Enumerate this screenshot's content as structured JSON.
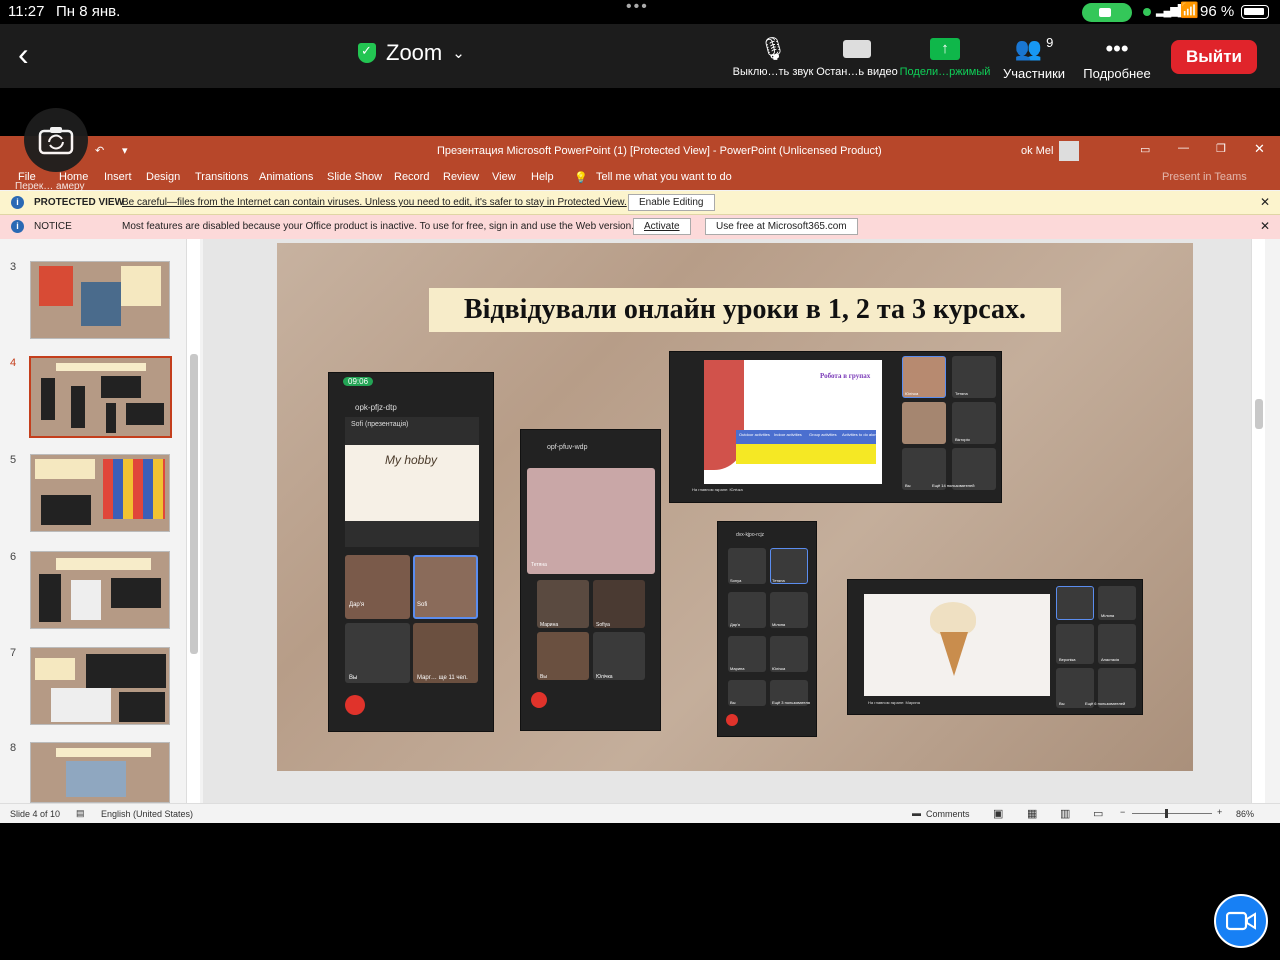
{
  "status": {
    "time": "11:27",
    "date": "Пн 8 янв.",
    "battery": "96 %"
  },
  "zoom": {
    "title": "Zoom",
    "mute": "Выклю…ть звук",
    "video": "Остан…ь видео",
    "share": "Подели…ржимый",
    "participants": "Участники",
    "participants_count": "9",
    "more": "Подробнее",
    "exit": "Выйти"
  },
  "ppt": {
    "window_title": "Презентация Microsoft PowerPoint (1) [Protected View]  -  PowerPoint (Unlicensed Product)",
    "user": "ok Mel",
    "camera_overlay": "Перек… амеру",
    "tabs": [
      "File",
      "Home",
      "Insert",
      "Design",
      "Transitions",
      "Animations",
      "Slide Show",
      "Record",
      "Review",
      "View",
      "Help"
    ],
    "tell_me": "Tell me what you want to do",
    "present_teams": "Present in Teams",
    "pv_label": "PROTECTED VIEW",
    "pv_text": "Be careful—files from the Internet can contain viruses. Unless you need to edit, it's safer to stay in Protected View.",
    "enable_editing": "Enable Editing",
    "notice_label": "NOTICE",
    "notice_text": "Most features are disabled because your Office product is inactive. To use for free, sign in and use the Web version.",
    "activate": "Activate",
    "use_free": "Use free at Microsoft365.com",
    "slide_numbers": [
      "3",
      "4",
      "5",
      "6",
      "7",
      "8"
    ],
    "slide_title": "Відвідували онлайн уроки в 1, 2 та 3 курсах.",
    "phone1": {
      "time": "09:06",
      "code": "opk-pfjz-dtp",
      "presenter": "Sofi (презентація)",
      "hobby": "My hobby",
      "tiles": [
        "Дар'я",
        "Sofi",
        "Вы",
        "Марг… ще 11 чел."
      ]
    },
    "phone2": {
      "code": "opf-pfuv-wdp",
      "names": [
        "Тетяна",
        "Марина",
        "Sofiya",
        "Вы",
        "Юлічка"
      ]
    },
    "meet1": {
      "heading": "Робота в групах",
      "cols": [
        "Outdoor activities",
        "Indoor activities",
        "Group activities",
        "Activities to do alone"
      ],
      "names": [
        "Юлічка",
        "Тетяна",
        "Вікторія",
        "Вы",
        "Ещё 14 пользователей"
      ],
      "bottom": "На главном экране: Юлічка"
    },
    "phone3": {
      "code": "dvx-kjpo-rcjz",
      "names": [
        "Sonya",
        "Тетяна",
        "Дар'я",
        "Міляна",
        "Марина",
        "Юлічка",
        "Вы",
        "Ещё 3 пользователя"
      ]
    },
    "meet2": {
      "names": [
        "Міляна",
        "Вероніка",
        "Анастасія",
        "Вы",
        "Ещё 6 пользователей"
      ],
      "bottom": "На главном экране: Марина"
    },
    "statusbar": {
      "slide": "Slide 4 of 10",
      "lang": "English (United States)",
      "comments": "Comments",
      "zoom": "86%"
    }
  }
}
